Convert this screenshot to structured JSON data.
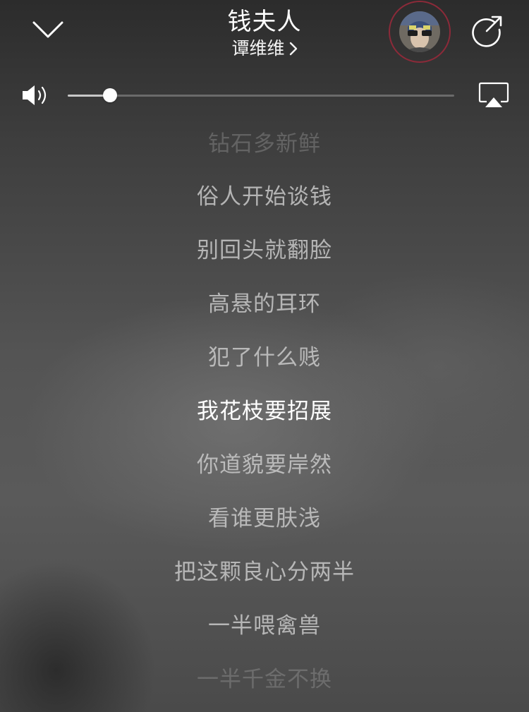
{
  "header": {
    "collapse_icon": "chevron-down-icon",
    "song_title": "钱夫人",
    "artist": "谭维维",
    "artist_chevron": "chevron-right-icon",
    "share_icon": "share-icon"
  },
  "volume": {
    "icon": "speaker-icon",
    "level": 0.11,
    "airplay_icon": "airplay-icon"
  },
  "colors": {
    "avatar_ring": "#8c2a39",
    "current_lyric": "#ffffff",
    "lyric": "#cdcdcd"
  },
  "lyrics": {
    "current_index": 5,
    "lines": [
      "钻石多新鲜",
      "俗人开始谈钱",
      "别回头就翻脸",
      "高悬的耳环",
      "犯了什么贱",
      "我花枝要招展",
      "你道貌要岸然",
      "看谁更肤浅",
      "把这颗良心分两半",
      "一半喂禽兽",
      "一半千金不换"
    ]
  }
}
